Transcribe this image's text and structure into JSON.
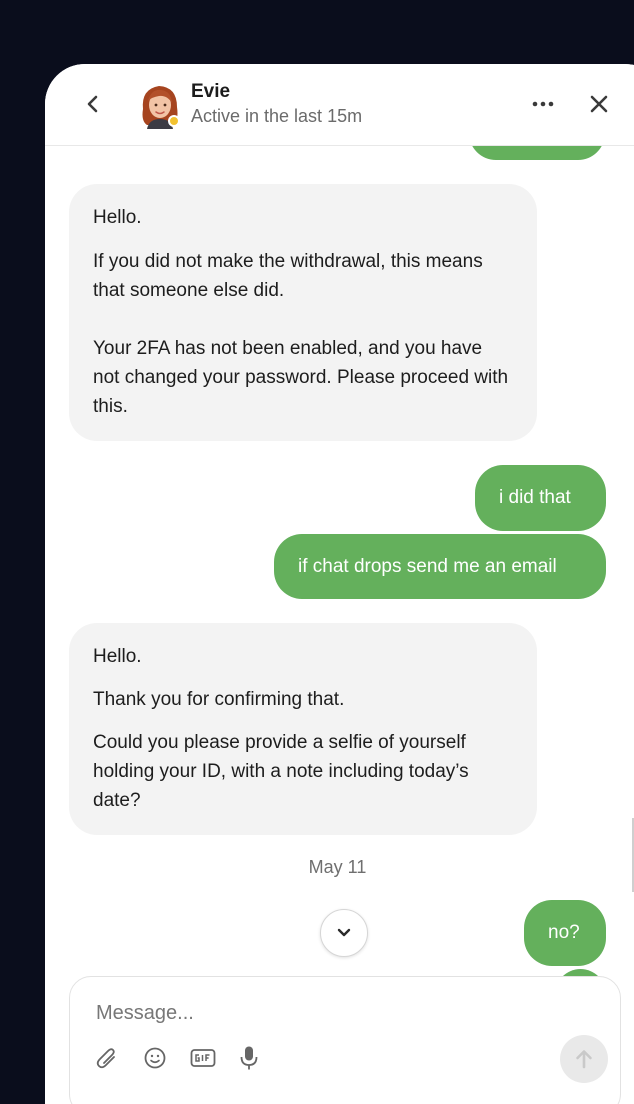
{
  "header": {
    "contact_name": "Evie",
    "status": "Active in the last 15m",
    "presence_color": "#f2c230"
  },
  "messages": [
    {
      "direction": "out",
      "text": ""
    },
    {
      "direction": "in",
      "paragraphs": [
        "Hello.",
        "If you did not make the withdrawal, this means that someone else did.",
        "Your 2FA has not been enabled, and you have not changed your password. Please proceed with this."
      ]
    },
    {
      "direction": "out",
      "text": "i did that"
    },
    {
      "direction": "out",
      "text": "if chat drops send me an email"
    },
    {
      "direction": "in",
      "paragraphs": [
        "Hello.",
        "Thank you for confirming that.",
        "Could you please provide a selfie of yourself holding your ID, with a note including today’s date?"
      ]
    },
    {
      "direction": "out",
      "text": "no?"
    },
    {
      "direction": "out",
      "text": ""
    }
  ],
  "date_separator": "May 11",
  "composer": {
    "placeholder": "Message...",
    "tools": [
      "attachment-icon",
      "emoji-icon",
      "gif-icon",
      "microphone-icon"
    ],
    "send_icon": "arrow-up-icon"
  },
  "colors": {
    "outgoing": "#64b05c",
    "incoming": "#f3f3f3",
    "backdrop": "#0a0d1c"
  }
}
